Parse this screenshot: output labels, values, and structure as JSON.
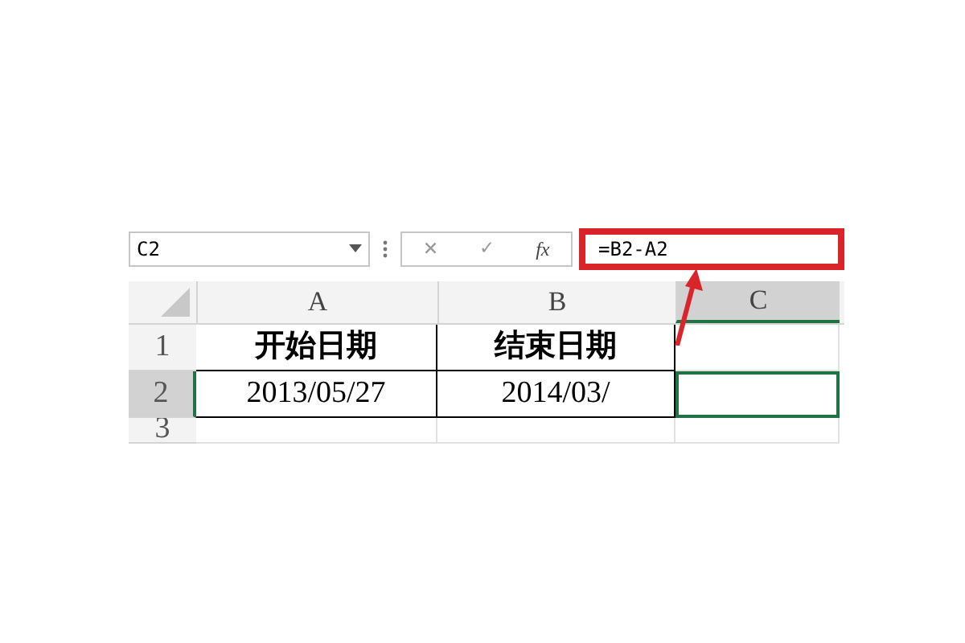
{
  "name_box": {
    "value": "C2"
  },
  "formula_bar": {
    "cancel": "×",
    "enter": "✓",
    "fx": "fx",
    "value": "=B2-A2",
    "highlighted": true
  },
  "columns": [
    {
      "label": "A",
      "selected": false
    },
    {
      "label": "B",
      "selected": false
    },
    {
      "label": "C",
      "selected": true
    }
  ],
  "rows": [
    {
      "label": "1",
      "selected": false,
      "cells": [
        {
          "text": "开始日期",
          "selected": false
        },
        {
          "text": "结束日期",
          "selected": false
        },
        {
          "selected": false
        }
      ]
    },
    {
      "label": "2",
      "selected": true,
      "cells": [
        {
          "text": "2013/05/27",
          "selected": false
        },
        {
          "text": "2014/03/",
          "selected": false
        },
        {
          "selected": true
        }
      ]
    },
    {
      "label": "3",
      "selected": false,
      "cells": [
        {
          "selected": false
        },
        {
          "selected": false
        },
        {
          "selected": false
        }
      ]
    }
  ]
}
